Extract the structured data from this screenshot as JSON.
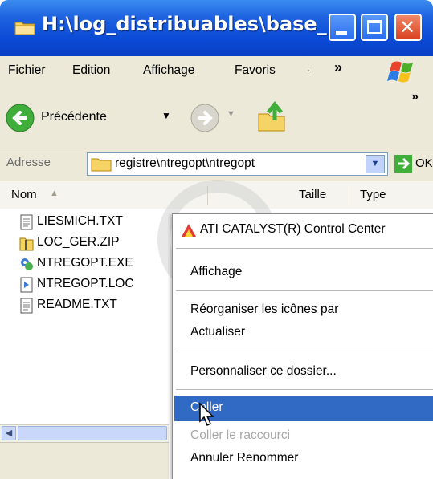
{
  "window": {
    "title": "H:\\log_distribuables\\base_..."
  },
  "menu": {
    "items": [
      "Fichier",
      "Edition",
      "Affichage",
      "Favoris"
    ],
    "overflow": "»"
  },
  "toolbar": {
    "back_label": "Précédente",
    "overflow": "»"
  },
  "address": {
    "label": "Adresse",
    "path": "registre\\ntregopt\\ntregopt",
    "go_label": "OK"
  },
  "columns": {
    "name": "Nom",
    "size": "Taille",
    "type": "Type"
  },
  "files": [
    {
      "name": "LIESMICH.TXT",
      "icon": "text-file-icon"
    },
    {
      "name": "LOC_GER.ZIP",
      "icon": "zip-folder-icon"
    },
    {
      "name": "NTREGOPT.EXE",
      "icon": "executable-icon"
    },
    {
      "name": "NTREGOPT.LOC",
      "icon": "loc-file-icon"
    },
    {
      "name": "README.TXT",
      "icon": "text-file-icon"
    }
  ],
  "context_menu": {
    "items": [
      {
        "label": "ATI CATALYST(R) Control Center",
        "state": "normal"
      },
      {
        "label": "Affichage",
        "state": "normal"
      },
      {
        "label": "Réorganiser les icônes par",
        "state": "normal"
      },
      {
        "label": "Actualiser",
        "state": "normal"
      },
      {
        "label": "Personnaliser ce dossier...",
        "state": "normal"
      },
      {
        "label": "Coller",
        "state": "highlighted"
      },
      {
        "label": "Coller le raccourci",
        "state": "disabled"
      },
      {
        "label": "Annuler Renommer",
        "state": "normal"
      }
    ]
  },
  "colors": {
    "titlebar": "#0a4ad6",
    "highlight": "#316ac5",
    "chrome": "#ece9d8"
  }
}
